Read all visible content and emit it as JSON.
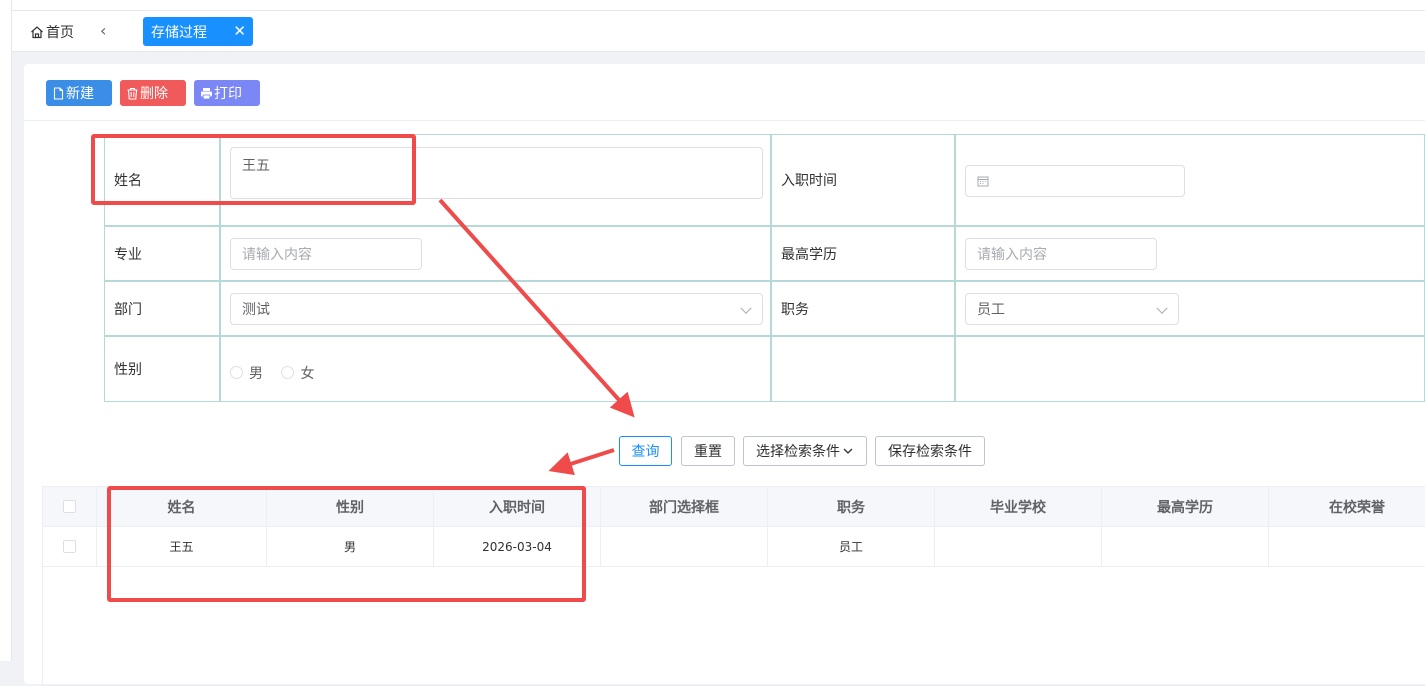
{
  "tabs": {
    "home_label": "首页",
    "back_icon": "chevron-left-icon",
    "active_label": "存储过程",
    "close_glyph": "✕"
  },
  "toolbar": {
    "new_label": "新建",
    "delete_label": "删除",
    "print_label": "打印"
  },
  "form": {
    "name_label": "姓名",
    "name_value": "王五",
    "hire_date_label": "入职时间",
    "major_label": "专业",
    "major_placeholder": "请输入内容",
    "education_label": "最高学历",
    "education_placeholder": "请输入内容",
    "dept_label": "部门",
    "dept_value": "测试",
    "position_label": "职务",
    "position_value": "员工",
    "gender_label": "性别",
    "gender_options": [
      "男",
      "女"
    ]
  },
  "actions": {
    "query_label": "查询",
    "reset_label": "重置",
    "select_conditions_label": "选择检索条件",
    "save_conditions_label": "保存检索条件"
  },
  "table": {
    "columns": [
      "姓名",
      "性别",
      "入职时间",
      "部门选择框",
      "职务",
      "毕业学校",
      "最高学历",
      "在校荣誉"
    ],
    "rows": [
      {
        "name": "王五",
        "gender": "男",
        "hire_date": "2026-03-04",
        "dept": "",
        "position": "员工",
        "school": "",
        "education": "",
        "honors": ""
      }
    ]
  },
  "colors": {
    "accent": "#1890ff",
    "new_button": "#3a8ee6",
    "delete_button": "#f05a5a",
    "print_button": "#7a87f5",
    "annotation": "#ef4b4b"
  }
}
